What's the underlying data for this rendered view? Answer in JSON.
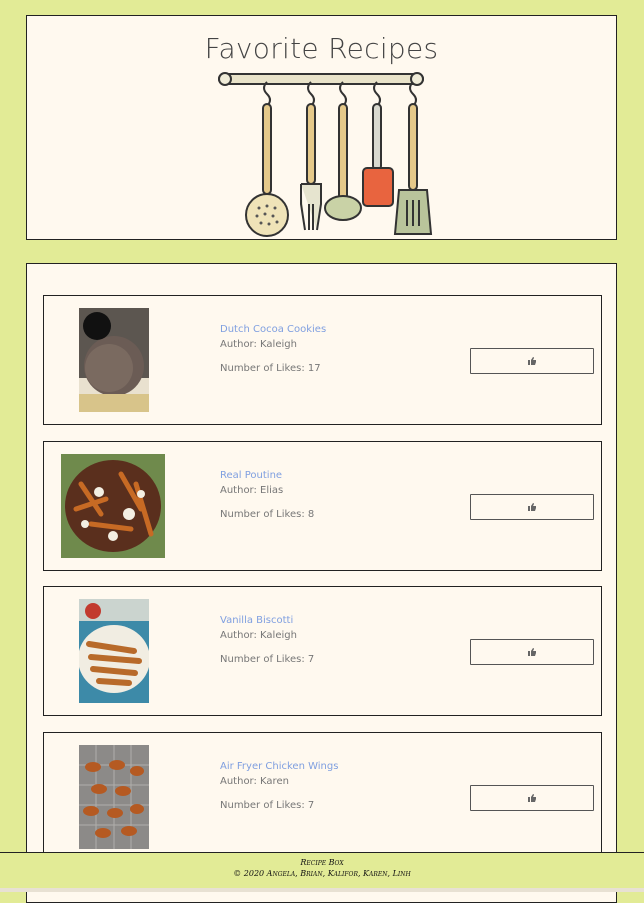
{
  "header": {
    "title": "Favorite Recipes"
  },
  "recipes": [
    {
      "title": "Dutch Cocoa Cookies",
      "author": "Author: Kaleigh",
      "likes": "Number of Likes: 17",
      "image": "cocoa-cookies-photo"
    },
    {
      "title": "Real Poutine",
      "author": "Author: Elias",
      "likes": "Number of Likes: 8",
      "image": "poutine-photo"
    },
    {
      "title": "Vanilla Biscotti",
      "author": "Author: Kaleigh",
      "likes": "Number of Likes: 7",
      "image": "biscotti-photo"
    },
    {
      "title": "Air Fryer Chicken Wings",
      "author": "Author: Karen",
      "likes": "Number of Likes: 7",
      "image": "chicken-wings-photo"
    }
  ],
  "like_icon": "thumbs-up-icon",
  "footer": {
    "line1": "Recipe Box",
    "line2": "© 2020 Angela, Brian, Kalifor, Karen, Linh"
  },
  "colors": {
    "background": "#e2eb96",
    "panel": "#fff9ef",
    "link": "#7f9fe0",
    "text": "#777777"
  }
}
